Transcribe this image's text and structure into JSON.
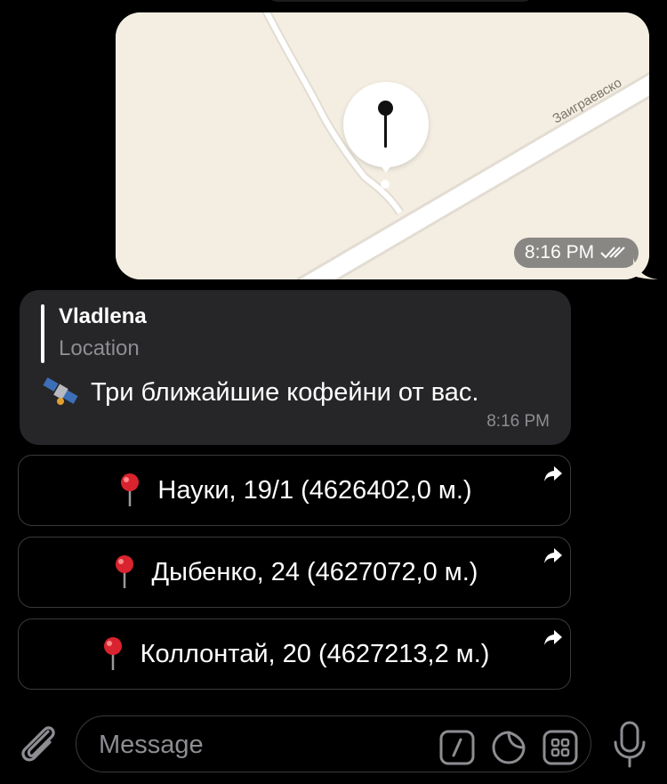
{
  "location_message": {
    "street_label": "Заиграевско",
    "time": "8:16 PM",
    "status": "double-check-icon"
  },
  "incoming_message": {
    "reply_author": "Vladlena",
    "reply_type": "Location",
    "emoji": "satellite-icon",
    "text": "Три ближайшие кофейни от вас.",
    "time": "8:16 PM"
  },
  "buttons": [
    {
      "icon": "pushpin-icon",
      "label": "Науки, 19/1 (4626402,0 м.)"
    },
    {
      "icon": "pushpin-icon",
      "label": "Дыбенко, 24 (4627072,0 м.)"
    },
    {
      "icon": "pushpin-icon",
      "label": "Коллонтай, 20 (4627213,2 м.)"
    }
  ],
  "composer": {
    "placeholder": "Message",
    "icons": [
      "paperclip-icon",
      "command-icon",
      "sticker-icon",
      "keyboard-grid-icon",
      "microphone-icon"
    ]
  }
}
